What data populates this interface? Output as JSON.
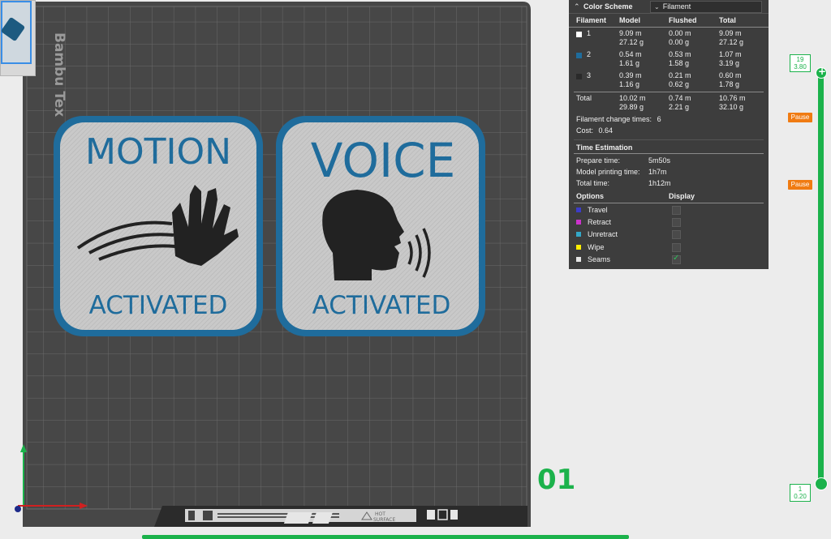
{
  "plate": {
    "brand_label": "Bambu Tex",
    "plate_number": "01",
    "bottom_bar_text_1": "HOT",
    "bottom_bar_text_2": "SURFACE"
  },
  "signs": [
    {
      "top": "MOTION",
      "bottom": "ACTIVATED",
      "icon": "waving-hand-icon"
    },
    {
      "top": "VOICE",
      "bottom": "ACTIVATED",
      "icon": "speaking-head-icon"
    }
  ],
  "legend": {
    "title": "Color Scheme",
    "scheme_value": "Filament",
    "columns": [
      "Filament",
      "Model",
      "Flushed",
      "Total"
    ],
    "filaments": [
      {
        "id": "1",
        "color": "#ffffff",
        "model_m": "9.09 m",
        "model_g": "27.12 g",
        "flushed_m": "0.00 m",
        "flushed_g": "0.00 g",
        "total_m": "9.09 m",
        "total_g": "27.12 g"
      },
      {
        "id": "2",
        "color": "#1f6c9c",
        "model_m": "0.54 m",
        "model_g": "1.61 g",
        "flushed_m": "0.53 m",
        "flushed_g": "1.58 g",
        "total_m": "1.07 m",
        "total_g": "3.19 g"
      },
      {
        "id": "3",
        "color": "#2a2a2a",
        "model_m": "0.39 m",
        "model_g": "1.16 g",
        "flushed_m": "0.21 m",
        "flushed_g": "0.62 g",
        "total_m": "0.60 m",
        "total_g": "1.78 g"
      }
    ],
    "total": {
      "label": "Total",
      "model_m": "10.02 m",
      "model_g": "29.89 g",
      "flushed_m": "0.74 m",
      "flushed_g": "2.21 g",
      "total_m": "10.76 m",
      "total_g": "32.10 g"
    },
    "change_times_label": "Filament change times:",
    "change_times": "6",
    "cost_label": "Cost:",
    "cost": "0.64",
    "time_title": "Time Estimation",
    "prepare_label": "Prepare time:",
    "prepare": "5m50s",
    "model_time_label": "Model printing time:",
    "model_time": "1h7m",
    "total_time_label": "Total time:",
    "total_time": "1h12m",
    "options_title": "Options",
    "display_title": "Display",
    "options": [
      {
        "label": "Travel",
        "color": "#3c3cc8",
        "checked": false
      },
      {
        "label": "Retract",
        "color": "#cc33cc",
        "checked": false
      },
      {
        "label": "Unretract",
        "color": "#33a8c8",
        "checked": false
      },
      {
        "label": "Wipe",
        "color": "#ffee00",
        "checked": false
      },
      {
        "label": "Seams",
        "color": "#e6e6e6",
        "checked": true
      }
    ]
  },
  "slider": {
    "top_layer": "19",
    "top_height": "3.80",
    "bottom_layer": "1",
    "bottom_height": "0.20",
    "pause_label": "Pause",
    "accent": "#1bb24b"
  },
  "colors": {
    "plate": "#4a4a4a",
    "sign_blue": "#1f6c9c",
    "sign_face": "#c8c8c8"
  }
}
